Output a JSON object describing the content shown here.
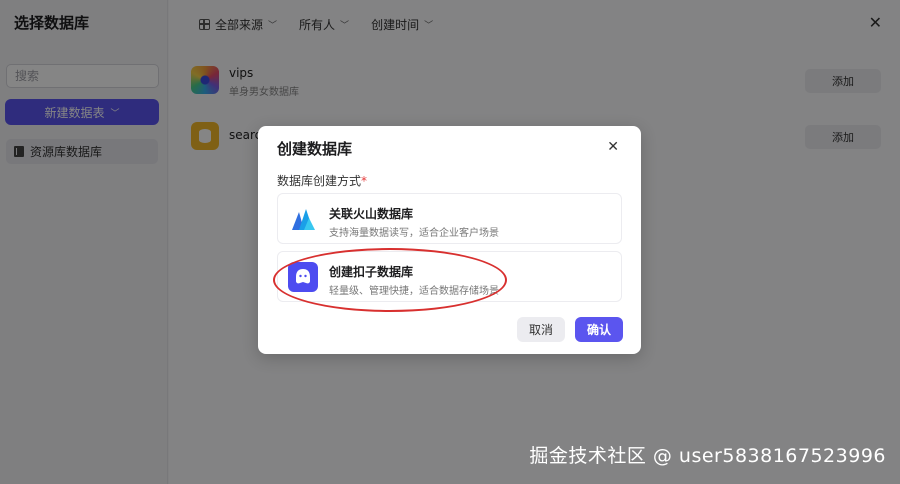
{
  "sidebar": {
    "title": "选择数据库",
    "search_placeholder": "搜索",
    "new_table_label": "新建数据表",
    "items": [
      {
        "label": "资源库数据库"
      }
    ]
  },
  "main": {
    "filters": [
      {
        "label": "全部来源"
      },
      {
        "label": "所有人"
      },
      {
        "label": "创建时间"
      }
    ],
    "close_glyph": "✕",
    "databases": [
      {
        "name": "vips",
        "desc": "单身男女数据库",
        "add_label": "添加"
      },
      {
        "name": "searc",
        "desc": "",
        "add_label": "添加"
      }
    ]
  },
  "dialog": {
    "title": "创建数据库",
    "close_glyph": "✕",
    "method_label": "数据库创建方式",
    "required_mark": "*",
    "options": [
      {
        "name": "关联火山数据库",
        "desc": "支持海量数据读写，适合企业客户场景",
        "icon": "volcano-icon"
      },
      {
        "name": "创建扣子数据库",
        "desc": "轻量级、管理快捷，适合数据存储场景",
        "icon": "coze-icon"
      }
    ],
    "cancel_label": "取消",
    "confirm_label": "确认"
  },
  "watermark": "掘金技术社区 @ user5838167523996",
  "colors": {
    "accent": "#5b55ef",
    "highlight": "#d8302f",
    "required": "#e63b3b"
  }
}
